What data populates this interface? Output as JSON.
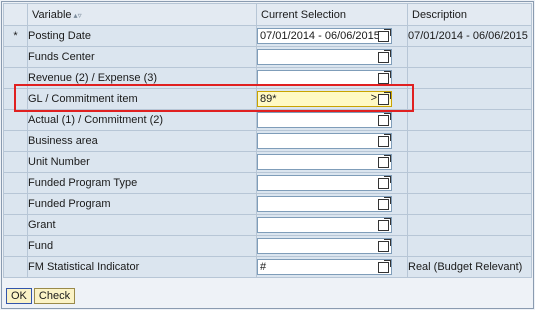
{
  "columns": {
    "variable": "Variable",
    "sort_icon": "▴▿",
    "selection": "Current Selection",
    "description": "Description"
  },
  "rows": [
    {
      "mandatory": "*",
      "name": "Posting Date",
      "value": "07/01/2014 - 06/06/2015",
      "description": "07/01/2014 - 06/06/2015"
    },
    {
      "mandatory": "",
      "name": "Funds Center",
      "value": "",
      "description": ""
    },
    {
      "mandatory": "",
      "name": "Revenue (2) / Expense (3)",
      "value": "",
      "description": ""
    },
    {
      "mandatory": "",
      "name": "GL / Commitment item",
      "value": "89*",
      "description": ""
    },
    {
      "mandatory": "",
      "name": "Actual (1) / Commitment (2)",
      "value": "",
      "description": ""
    },
    {
      "mandatory": "",
      "name": "Business area",
      "value": "",
      "description": ""
    },
    {
      "mandatory": "",
      "name": "Unit Number",
      "value": "",
      "description": ""
    },
    {
      "mandatory": "",
      "name": "Funded Program Type",
      "value": "",
      "description": ""
    },
    {
      "mandatory": "",
      "name": "Funded Program",
      "value": "",
      "description": ""
    },
    {
      "mandatory": "",
      "name": "Grant",
      "value": "",
      "description": ""
    },
    {
      "mandatory": "",
      "name": "Fund",
      "value": "",
      "description": ""
    },
    {
      "mandatory": "",
      "name": "FM Statistical Indicator",
      "value": "#",
      "description": "Real (Budget Relevant)"
    }
  ],
  "active_row": {
    "arrow": ">"
  },
  "buttons": {
    "ok": "OK",
    "check": "Check"
  },
  "colors": {
    "highlight_border": "#e02020",
    "active_input": "#fff9c4"
  }
}
